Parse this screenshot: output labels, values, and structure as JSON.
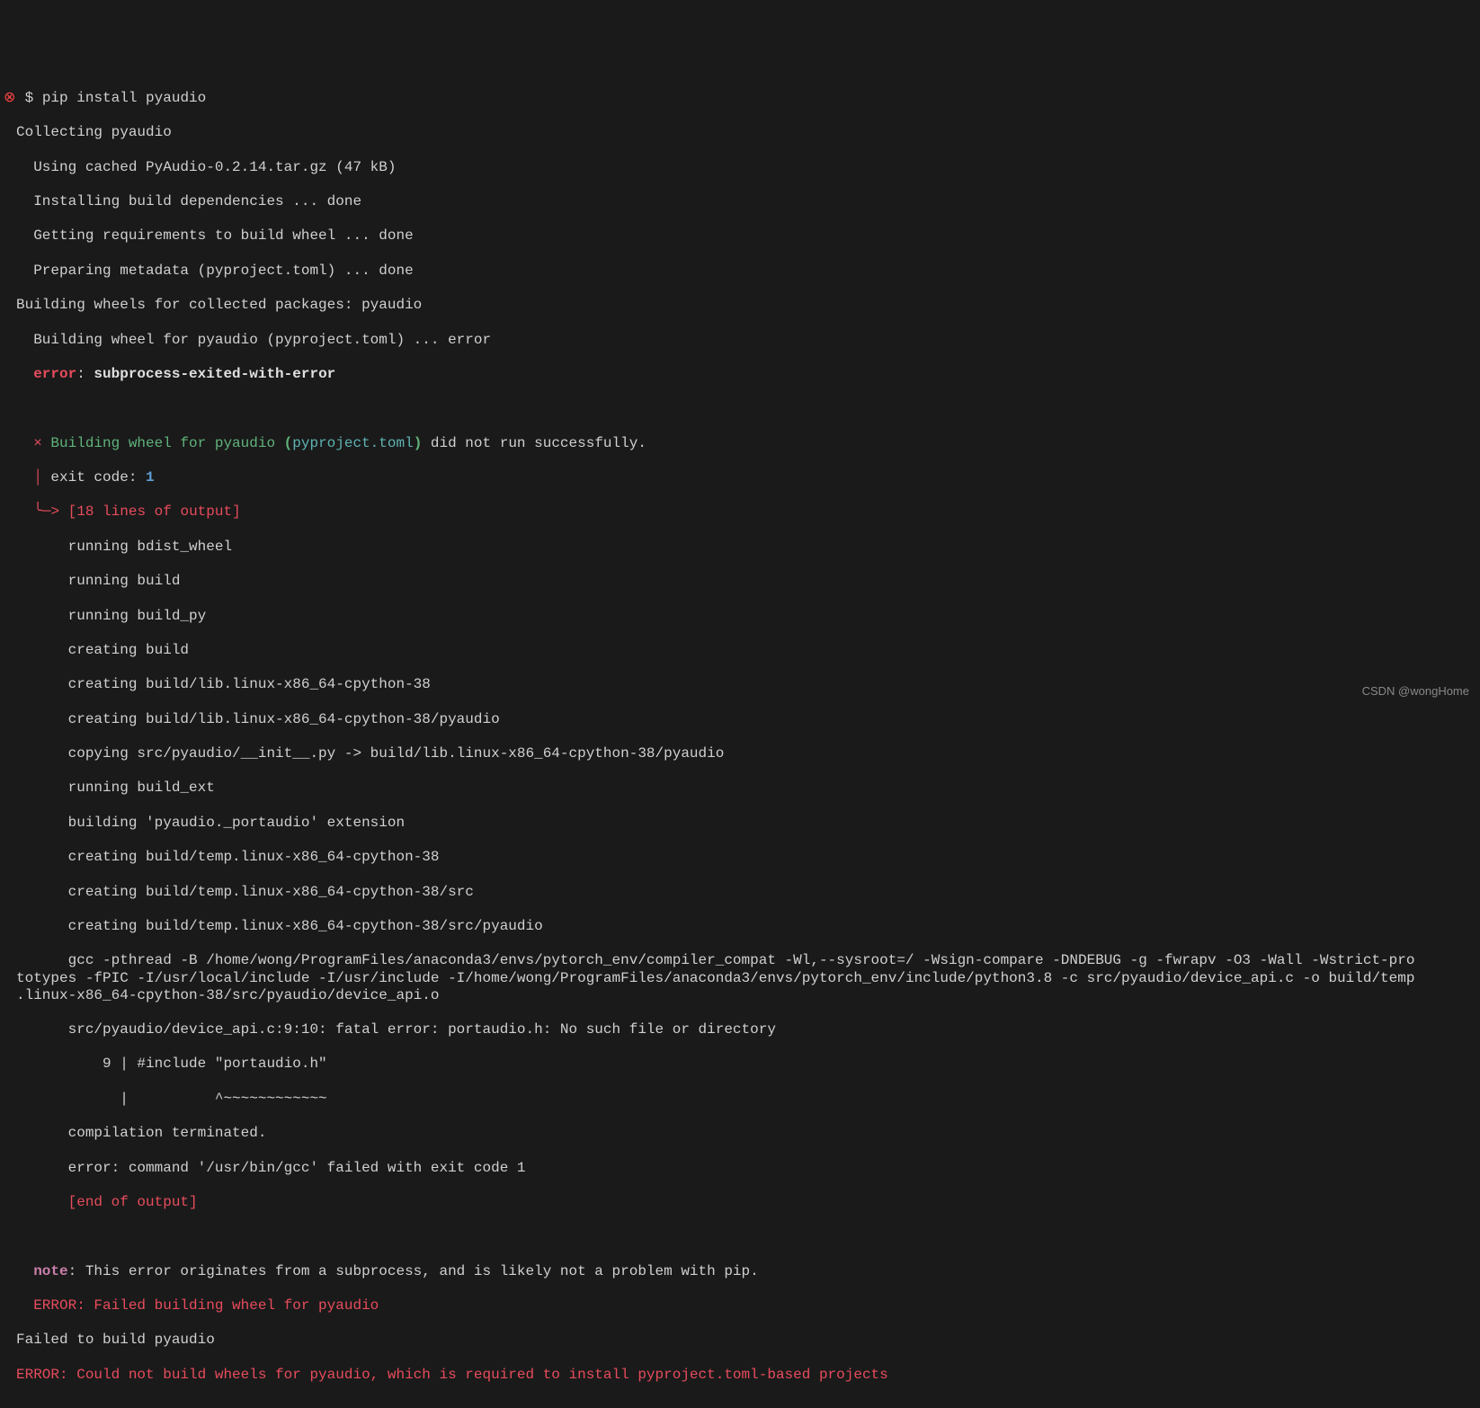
{
  "prompt": {
    "symbol": "⊗",
    "dollar": "$",
    "command": "pip install pyaudio"
  },
  "lines": {
    "l1": "Collecting pyaudio",
    "l2": "  Using cached PyAudio-0.2.14.tar.gz (47 kB)",
    "l3": "  Installing build dependencies ... done",
    "l4": "  Getting requirements to build wheel ... done",
    "l5": "  Preparing metadata (pyproject.toml) ... done",
    "l6": "Building wheels for collected packages: pyaudio",
    "l7": "  Building wheel for pyaudio (pyproject.toml) ... error",
    "l8a": "  ",
    "l8_error": "error",
    "l8b": ": ",
    "l8_msg": "subprocess-exited-with-error",
    "l9": "  ",
    "l10_x": "  × ",
    "l10_a": "Building wheel for pyaudio ",
    "l10_p1": "(",
    "l10_b": "pyproject.toml",
    "l10_p2": ")",
    "l10_c": " did not run successfully.",
    "l11_tree": "  │ ",
    "l11_a": "exit code: ",
    "l11_b": "1",
    "l12_tree": "  ╰─> ",
    "l12_a": "[18 lines of output]",
    "l13": "      running bdist_wheel",
    "l14": "      running build",
    "l15": "      running build_py",
    "l16": "      creating build",
    "l17": "      creating build/lib.linux-x86_64-cpython-38",
    "l18": "      creating build/lib.linux-x86_64-cpython-38/pyaudio",
    "l19": "      copying src/pyaudio/__init__.py -> build/lib.linux-x86_64-cpython-38/pyaudio",
    "l20": "      running build_ext",
    "l21": "      building 'pyaudio._portaudio' extension",
    "l22": "      creating build/temp.linux-x86_64-cpython-38",
    "l23": "      creating build/temp.linux-x86_64-cpython-38/src",
    "l24": "      creating build/temp.linux-x86_64-cpython-38/src/pyaudio",
    "l25": "      gcc -pthread -B /home/wong/ProgramFiles/anaconda3/envs/pytorch_env/compiler_compat -Wl,--sysroot=/ -Wsign-compare -DNDEBUG -g -fwrapv -O3 -Wall -Wstrict-pro\ntotypes -fPIC -I/usr/local/include -I/usr/include -I/home/wong/ProgramFiles/anaconda3/envs/pytorch_env/include/python3.8 -c src/pyaudio/device_api.c -o build/temp\n.linux-x86_64-cpython-38/src/pyaudio/device_api.o",
    "l26": "      src/pyaudio/device_api.c:9:10: fatal error: portaudio.h: No such file or directory",
    "l27": "          9 | #include \"portaudio.h\"",
    "l28": "            |          ^~~~~~~~~~~~~",
    "l29": "      compilation terminated.",
    "l30": "      error: command '/usr/bin/gcc' failed with exit code 1",
    "l31_a": "      ",
    "l31_b": "[end of output]",
    "l32": "  ",
    "l33_a": "  ",
    "l33_note": "note",
    "l33_b": ": This error originates from a subprocess, and is likely not a problem with pip.",
    "l34_a": "  ",
    "l34_b": "ERROR: Failed building wheel for pyaudio",
    "l35": "Failed to build pyaudio",
    "l36": "ERROR: Could not build wheels for pyaudio, which is required to install pyproject.toml-based projects"
  },
  "watermark": "CSDN @wongHome"
}
